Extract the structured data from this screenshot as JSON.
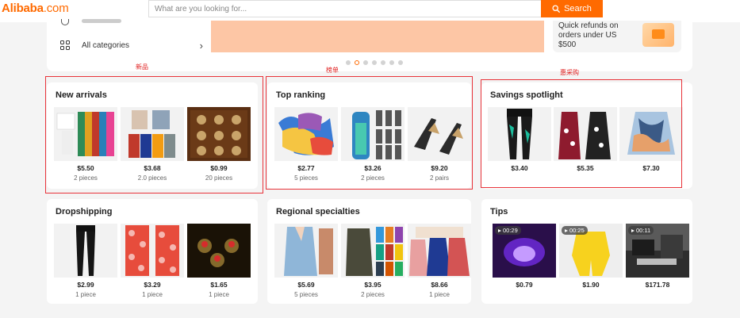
{
  "header": {
    "logo_text": "Alibaba",
    "logo_suffix": ".com",
    "search_placeholder": "What are you looking for...",
    "search_button": "Search"
  },
  "hero": {
    "all_categories": "All categories",
    "refund_text": "Quick refunds on orders under US $500",
    "carousel_total": 7,
    "carousel_active": 1
  },
  "annotations": {
    "new": "新品",
    "ranking": "榜单",
    "deals": "惠采购"
  },
  "sections": {
    "new_arrivals": {
      "title": "New arrivals",
      "products": [
        {
          "price": "$5.50",
          "qty": "2 pieces"
        },
        {
          "price": "$3.68",
          "qty": "2.0 pieces"
        },
        {
          "price": "$0.99",
          "qty": "20 pieces"
        }
      ]
    },
    "top_ranking": {
      "title": "Top ranking",
      "products": [
        {
          "price": "$2.77",
          "qty": "5 pieces"
        },
        {
          "price": "$3.26",
          "qty": "2 pieces"
        },
        {
          "price": "$9.20",
          "qty": "2 pairs"
        }
      ]
    },
    "savings": {
      "title": "Savings spotlight",
      "products": [
        {
          "price": "$3.40"
        },
        {
          "price": "$5.35"
        },
        {
          "price": "$7.30"
        }
      ]
    },
    "dropshipping": {
      "title": "Dropshipping",
      "products": [
        {
          "price": "$2.99",
          "qty": "1 piece"
        },
        {
          "price": "$3.29",
          "qty": "1 piece"
        },
        {
          "price": "$1.65",
          "qty": "1 piece"
        }
      ]
    },
    "regional": {
      "title": "Regional specialties",
      "products": [
        {
          "price": "$5.69",
          "qty": "5 pieces"
        },
        {
          "price": "$3.95",
          "qty": "2 pieces"
        },
        {
          "price": "$8.66",
          "qty": "1 piece"
        }
      ]
    },
    "tips": {
      "title": "Tips",
      "products": [
        {
          "price": "$0.79",
          "duration": "00:29"
        },
        {
          "price": "$1.90",
          "duration": "00:25"
        },
        {
          "price": "$171.78",
          "duration": "00:11"
        }
      ]
    }
  },
  "colors": {
    "brand": "#ff6a00",
    "annotation_red": "#e8333a"
  }
}
